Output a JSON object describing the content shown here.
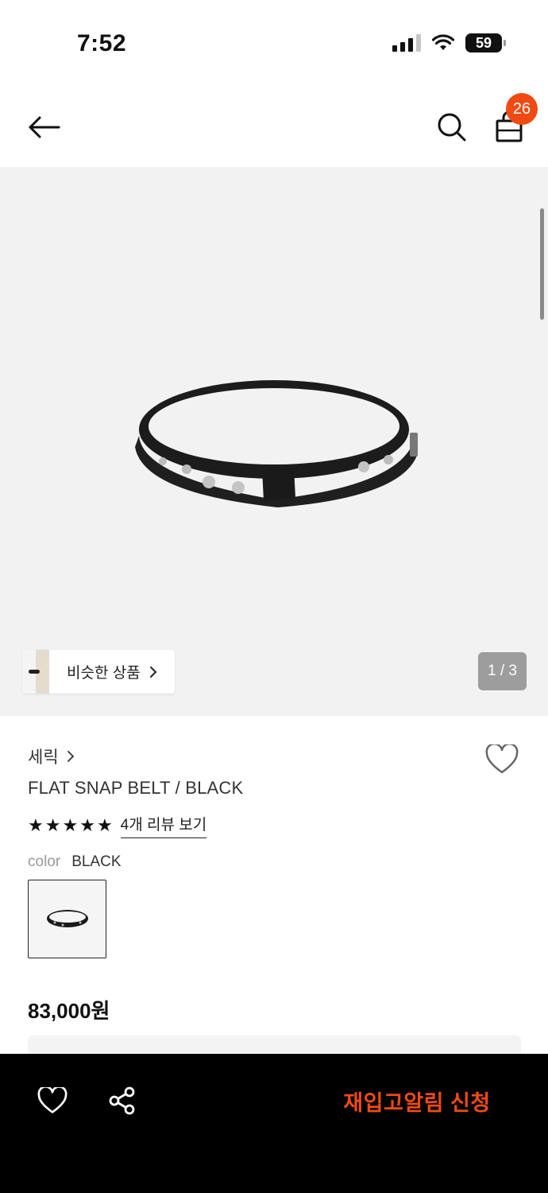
{
  "status_bar": {
    "time": "7:52",
    "battery": "59"
  },
  "header": {
    "cart_count": "26",
    "back_icon": "arrow-left-icon",
    "search_icon": "search-icon",
    "cart_icon": "shopping-bag-icon"
  },
  "gallery": {
    "similar_label": "비슷한 상품",
    "page_counter": "1 / 3"
  },
  "product": {
    "brand": "세릭",
    "name": "FLAT SNAP BELT / BLACK",
    "rating": 5,
    "review_link": "4개 리뷰 보기",
    "color_label": "color",
    "color_value": "BLACK",
    "price": "83,000원"
  },
  "bottom_bar": {
    "restock_label": "재입고알림 신청",
    "accent_color": "#f04a12"
  }
}
